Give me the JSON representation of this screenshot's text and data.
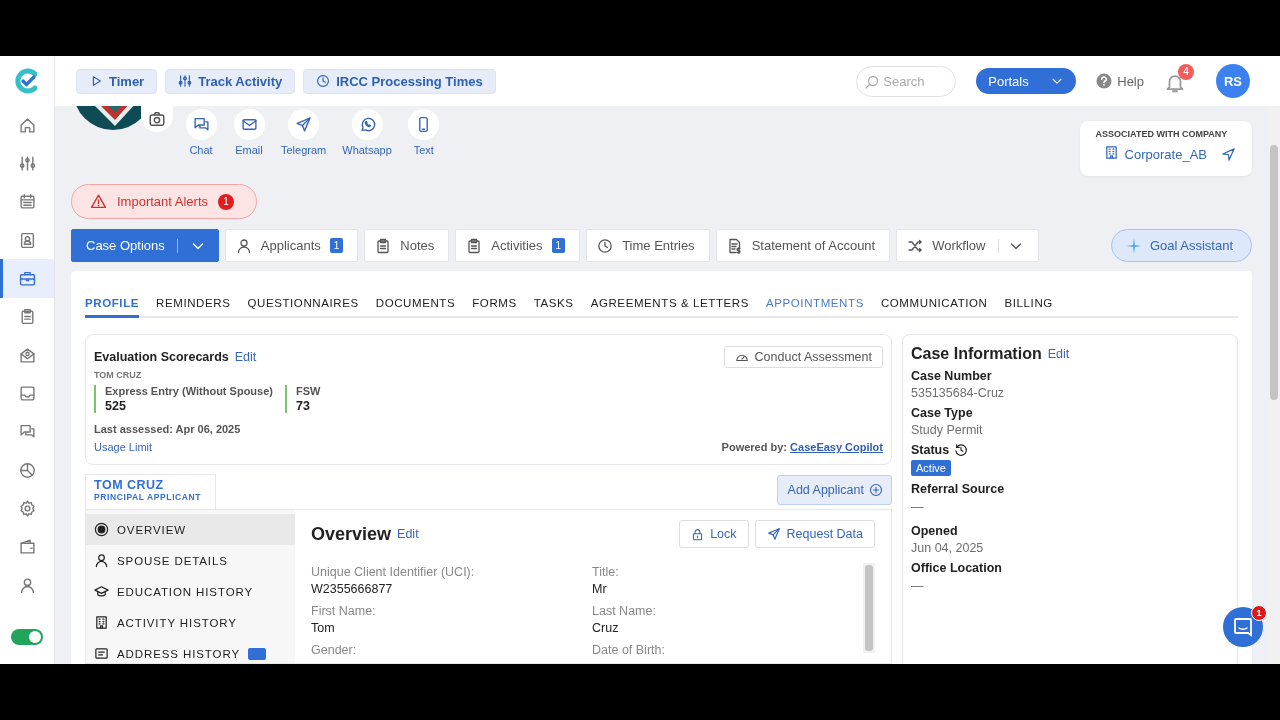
{
  "header": {
    "quick_actions": [
      {
        "label": "Timer",
        "kind": "play"
      },
      {
        "label": "Track Activity",
        "kind": "sliders"
      },
      {
        "label": "IRCC Processing Times",
        "kind": "clock"
      }
    ],
    "search": {
      "placeholder": "Search"
    },
    "portals": "Portals",
    "help": "Help",
    "notification_count": "4",
    "user_initials": "RS"
  },
  "sidebar": {
    "items": [
      {
        "kind": "home",
        "selected": false
      },
      {
        "kind": "sliders",
        "selected": false
      },
      {
        "kind": "calendar",
        "selected": false
      },
      {
        "kind": "contact",
        "selected": false
      },
      {
        "kind": "briefcase",
        "selected": true
      },
      {
        "kind": "clipboard",
        "selected": false
      },
      {
        "kind": "mailopen",
        "selected": false
      },
      {
        "kind": "inbox",
        "selected": false
      },
      {
        "kind": "chat",
        "selected": false
      },
      {
        "kind": "pie",
        "selected": false
      },
      {
        "kind": "gear",
        "selected": false
      },
      {
        "kind": "wallet",
        "selected": false
      },
      {
        "kind": "user",
        "selected": false
      }
    ],
    "toggle": {
      "on": true
    }
  },
  "contacts": [
    {
      "label": "Chat",
      "kind": "chat"
    },
    {
      "label": "Email",
      "kind": "mail"
    },
    {
      "label": "Telegram",
      "kind": "send"
    },
    {
      "label": "Whatsapp",
      "kind": "whatsapp"
    },
    {
      "label": "Text",
      "kind": "phone"
    }
  ],
  "company": {
    "heading": "ASSOCIATED WITH COMPANY",
    "name": "Corporate_AB"
  },
  "alerts": {
    "label": "Important Alerts",
    "count": "1"
  },
  "case_actions": [
    {
      "label": "Case Options",
      "kind": "primary"
    },
    {
      "label": "Applicants",
      "kind": "user",
      "count": "1"
    },
    {
      "label": "Notes",
      "kind": "clipboard"
    },
    {
      "label": "Activities",
      "kind": "clipboard",
      "count": "1"
    },
    {
      "label": "Time Entries",
      "kind": "clock"
    },
    {
      "label": "Statement of Account",
      "kind": "invoice"
    },
    {
      "label": "Workflow",
      "kind": "shuffle",
      "dropdown": true
    }
  ],
  "goal_assistant": "Goal Assistant",
  "tabs": [
    {
      "label": "PROFILE",
      "selected": true,
      "hovered": false
    },
    {
      "label": "REMINDERS",
      "selected": false,
      "hovered": false
    },
    {
      "label": "QUESTIONNAIRES",
      "selected": false,
      "hovered": false
    },
    {
      "label": "DOCUMENTS",
      "selected": false,
      "hovered": false
    },
    {
      "label": "FORMS",
      "selected": false,
      "hovered": false
    },
    {
      "label": "TASKS",
      "selected": false,
      "hovered": false
    },
    {
      "label": "AGREEMENTS & LETTERS",
      "selected": false,
      "hovered": false
    },
    {
      "label": "APPOINTMENTS",
      "selected": false,
      "hovered": true
    },
    {
      "label": "COMMUNICATION",
      "selected": false,
      "hovered": false
    },
    {
      "label": "BILLING",
      "selected": false,
      "hovered": false
    }
  ],
  "scorecard": {
    "title": "Evaluation Scorecards",
    "edit": "Edit",
    "person": "TOM CRUZ",
    "conduct": "Conduct Assessment",
    "scores": [
      {
        "label": "Express Entry (Without Spouse)",
        "value": "525"
      },
      {
        "label": "FSW",
        "value": "73"
      }
    ],
    "last_assessed": "Last assessed: Apr 06, 2025",
    "usage_limit": "Usage Limit",
    "powered_by": "Powered by:",
    "powered_link": "CaseEasy Copilot"
  },
  "applicant": {
    "name": "TOM CRUZ",
    "role": "PRINCIPAL APPLICANT"
  },
  "add_applicant": "Add Applicant",
  "sections": [
    {
      "label": "OVERVIEW",
      "kind": "target",
      "selected": true
    },
    {
      "label": "SPOUSE DETAILS",
      "kind": "user",
      "selected": false
    },
    {
      "label": "EDUCATION HISTORY",
      "kind": "cap",
      "selected": false
    },
    {
      "label": "ACTIVITY HISTORY",
      "kind": "building",
      "selected": false
    },
    {
      "label": "ADDRESS HISTORY",
      "kind": "card",
      "selected": false,
      "badge": true
    }
  ],
  "overview": {
    "title": "Overview",
    "edit": "Edit",
    "lock": "Lock",
    "request": "Request Data",
    "fields": [
      {
        "label": "Unique Client Identifier (UCI):",
        "value": "W2355666877"
      },
      {
        "label": "Title:",
        "value": "Mr"
      },
      {
        "label": "First Name:",
        "value": "Tom"
      },
      {
        "label": "Last Name:",
        "value": "Cruz"
      },
      {
        "label": "Gender:"
      },
      {
        "label": "Date of Birth:"
      }
    ]
  },
  "case_information": {
    "title": "Case Information",
    "edit": "Edit",
    "fields": [
      {
        "label": "Case Number",
        "value": "535135684-Cruz",
        "kind": "text"
      },
      {
        "label": "Case Type",
        "value": "Study Permit",
        "kind": "text"
      },
      {
        "label": "Status",
        "value": "Active",
        "kind": "status"
      },
      {
        "label": "Referral Source",
        "value": "—",
        "kind": "text"
      },
      {
        "label": "Opened",
        "value": "Jun 04, 2025",
        "kind": "text"
      },
      {
        "label": "Office Location",
        "value": "—",
        "kind": "text"
      }
    ]
  },
  "chat_widget": {
    "count": "1"
  }
}
